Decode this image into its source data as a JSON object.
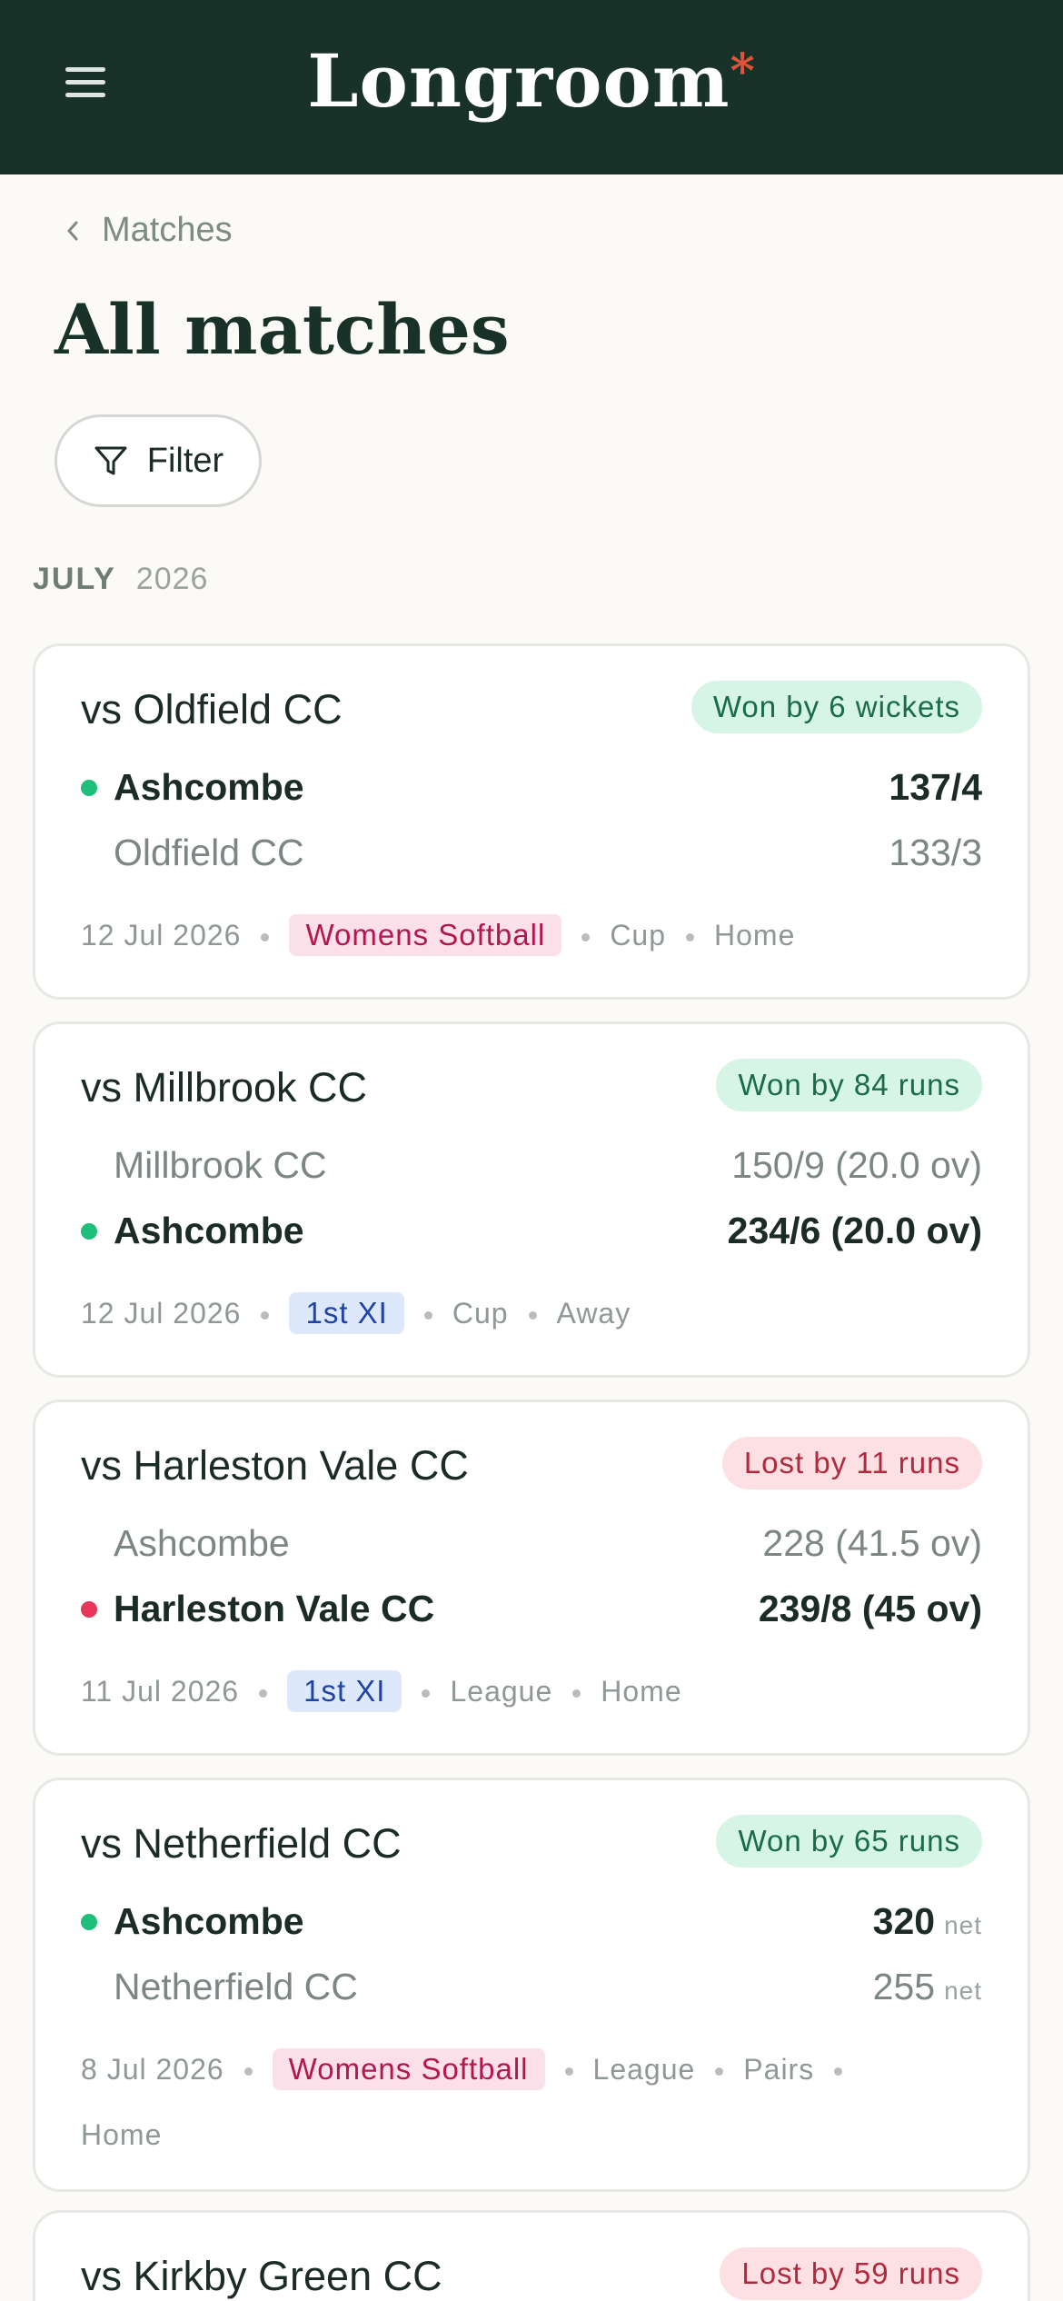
{
  "header": {
    "logo_text": "Longroom",
    "logo_mark": "*",
    "menu_icon": "hamburger-icon"
  },
  "breadcrumb": {
    "label": "Matches",
    "icon": "chevron-left-icon"
  },
  "page_title": "All matches",
  "filter": {
    "label": "Filter",
    "icon": "funnel-icon"
  },
  "month": {
    "month": "JULY",
    "year": "2026"
  },
  "colors": {
    "header_bg": "#193229",
    "won": "#1a6b49",
    "lost": "#b02a3d",
    "accent_star": "#e0533b"
  },
  "matches": [
    {
      "opponent": "vs Oldfield CC",
      "result": "Won by 6 wickets",
      "rows": [
        {
          "team": "Ashcombe",
          "score": "137/4"
        },
        {
          "team": "Oldfield CC",
          "score": "133/3"
        }
      ],
      "date": "12 Jul 2026",
      "tag": "Womens Softball",
      "competition": "Cup",
      "venue": "Home"
    },
    {
      "opponent": "vs Millbrook CC",
      "result": "Won by 84 runs",
      "rows": [
        {
          "team": "Millbrook CC",
          "score": "150/9 (20.0 ov)"
        },
        {
          "team": "Ashcombe",
          "score": "234/6 (20.0 ov)"
        }
      ],
      "date": "12 Jul 2026",
      "tag": "1st XI",
      "competition": "Cup",
      "venue": "Away"
    },
    {
      "opponent": "vs Harleston Vale CC",
      "result": "Lost by 11 runs",
      "rows": [
        {
          "team": "Ashcombe",
          "score": "228 (41.5 ov)"
        },
        {
          "team": "Harleston Vale CC",
          "score": "239/8 (45 ov)"
        }
      ],
      "date": "11 Jul 2026",
      "tag": "1st XI",
      "competition": "League",
      "venue": "Home"
    },
    {
      "opponent": "vs Netherfield CC",
      "result": "Won by 65 runs",
      "rows": [
        {
          "team": "Ashcombe",
          "score": "320",
          "suffix": "net"
        },
        {
          "team": "Netherfield CC",
          "score": "255",
          "suffix": "net"
        }
      ],
      "date": "8 Jul 2026",
      "tag": "Womens Softball",
      "competition": "League",
      "format": "Pairs",
      "venue": "Home"
    },
    {
      "opponent": "vs Kirkby Green CC",
      "result": "Lost by 59 runs"
    }
  ]
}
